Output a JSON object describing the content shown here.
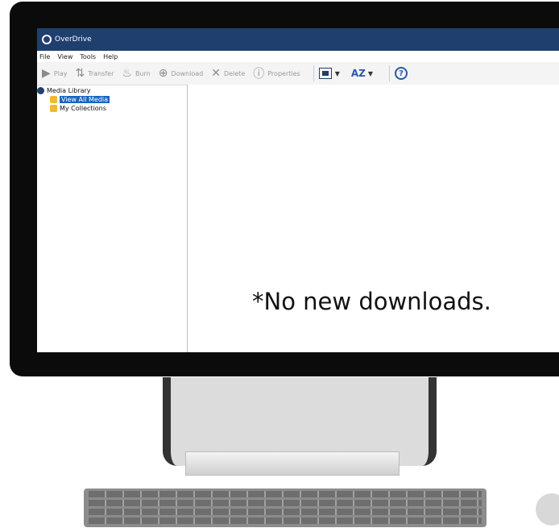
{
  "window": {
    "title": "OverDrive"
  },
  "menu": [
    "File",
    "View",
    "Tools",
    "Help"
  ],
  "toolbar": {
    "play": "Play",
    "transfer": "Transfer",
    "burn": "Burn",
    "download": "Download",
    "delete": "Delete",
    "properties": "Properties"
  },
  "tree": {
    "root": "Media Library",
    "items": [
      {
        "label": "View All Media"
      },
      {
        "label": "My Collections"
      }
    ]
  },
  "note": "*No new downloads."
}
